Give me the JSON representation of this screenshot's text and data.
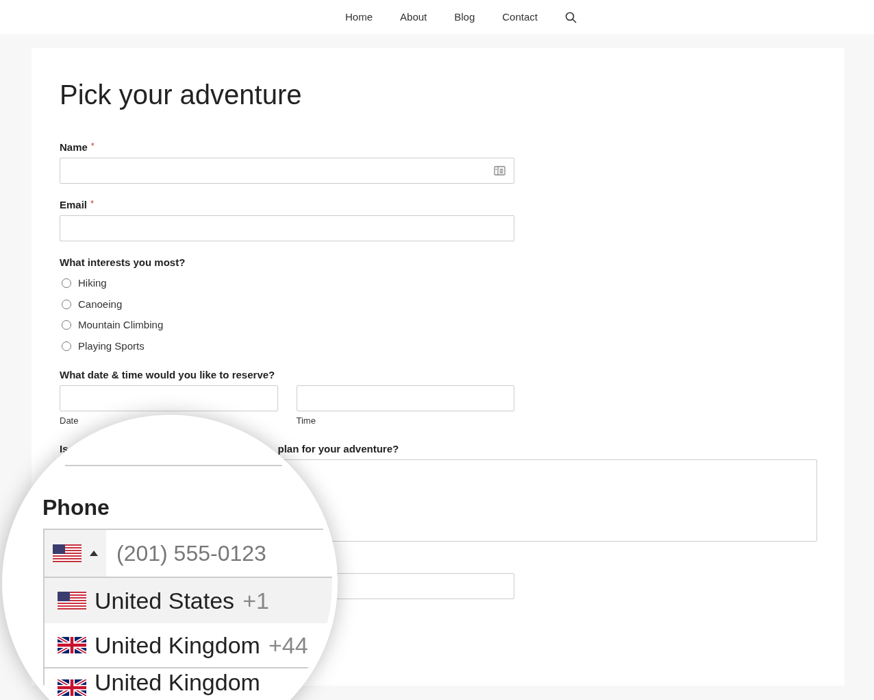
{
  "nav": {
    "items": [
      {
        "label": "Home"
      },
      {
        "label": "About"
      },
      {
        "label": "Blog"
      },
      {
        "label": "Contact"
      }
    ]
  },
  "form": {
    "title": "Pick your adventure",
    "fields": [
      {
        "label": "Name",
        "required_mark": "*",
        "kind": "name"
      },
      {
        "label": "Email",
        "required_mark": "*",
        "kind": "text"
      }
    ],
    "interests": {
      "label": "What interests you most?",
      "options": [
        {
          "label": "Hiking",
          "selected": false
        },
        {
          "label": "Canoeing",
          "selected": false
        },
        {
          "label": "Mountain Climbing",
          "selected": false
        },
        {
          "label": "Playing Sports",
          "selected": false
        }
      ]
    },
    "reservation": {
      "label": "What date & time would you like to reserve?",
      "sublabels": [
        "Date",
        "Time"
      ]
    },
    "question": {
      "label_start": "Is",
      "label_end": "plan for your adventure?"
    }
  },
  "magnifier": {
    "phone_label": "Phone",
    "placeholder": "(201) 555-0123",
    "dropdown_open": true,
    "countries": [
      {
        "name": "United States",
        "code": "+1",
        "kind": "us",
        "selected": true
      },
      {
        "name": "United Kingdom",
        "code": "+44",
        "kind": "uk",
        "selected": false
      },
      {
        "name": "United Kingdom",
        "kind": "uk",
        "selected": false
      }
    ]
  }
}
